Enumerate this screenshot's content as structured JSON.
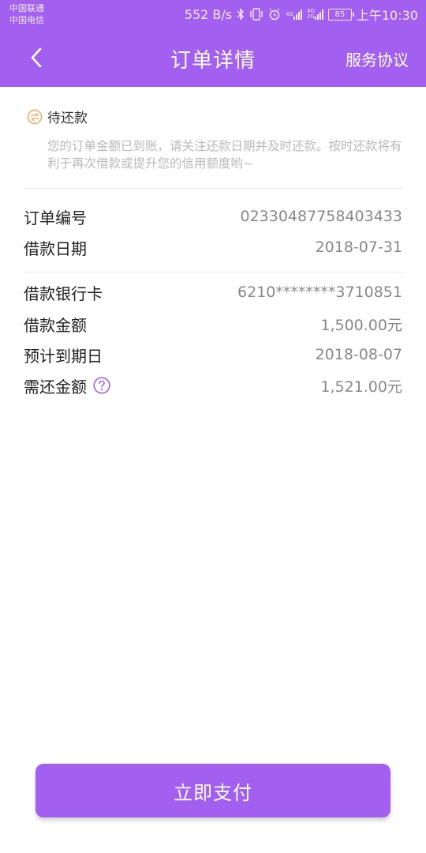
{
  "status_bar": {
    "carrier1": "中国联通",
    "carrier2": "中国电信",
    "speed": "552 B/s",
    "net1_top": "4G",
    "net2_top": "4G",
    "net2_bottom": "2G",
    "battery": "85",
    "time": "上午10:30"
  },
  "header": {
    "title": "订单详情",
    "action": "服务协议",
    "background": "#a25ff0"
  },
  "order_status": {
    "icon": "exchange-circle-icon",
    "label": "待还款",
    "notice": "您的订单金额已到账，请关注还款日期并及时还款。按时还款将有利于再次借款或提升您的信用额度哟~"
  },
  "order_info": [
    {
      "label": "订单编号",
      "value": "02330487758403433"
    },
    {
      "label": "借款日期",
      "value": "2018-07-31"
    }
  ],
  "loan_info": [
    {
      "label": "借款银行卡",
      "value": "6210********3710851"
    },
    {
      "label": "借款金额",
      "value": "1,500.00元"
    },
    {
      "label": "预计到期日",
      "value": "2018-08-07"
    },
    {
      "label": "需还金额",
      "value": "1,521.00元",
      "icon": "question-circle-icon"
    }
  ],
  "pay_button": "立即支付",
  "colors": {
    "accent": "#a25ff0",
    "status_icon": "#f0a55c"
  }
}
